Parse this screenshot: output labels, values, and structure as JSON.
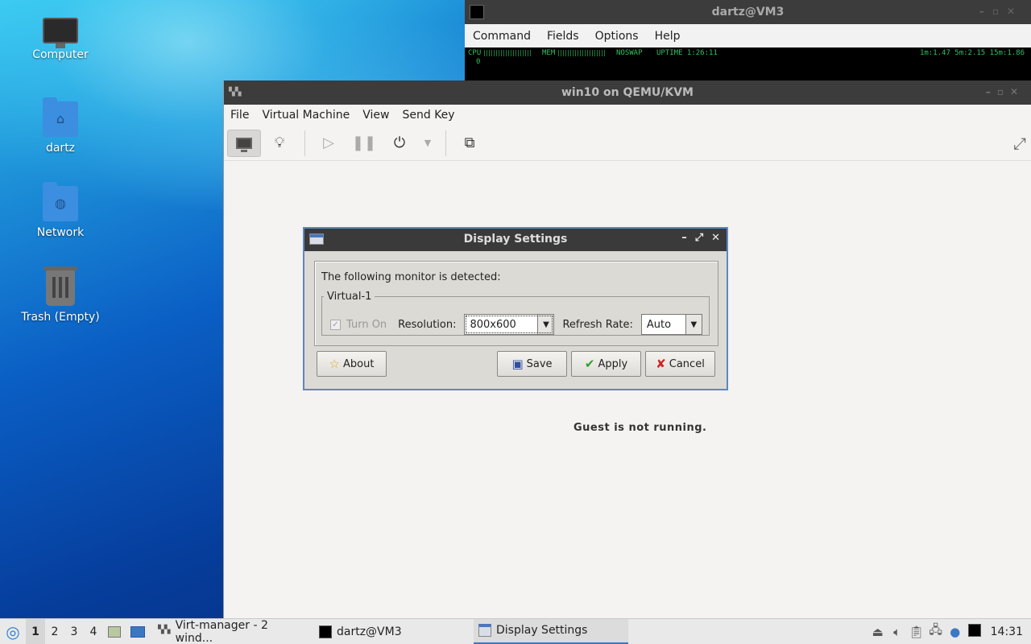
{
  "desktop": {
    "icons": [
      {
        "label": "Computer",
        "icon": "computer-icon"
      },
      {
        "label": "dartz",
        "icon": "home-folder-icon"
      },
      {
        "label": "Network",
        "icon": "network-folder-icon"
      },
      {
        "label": "Trash (Empty)",
        "icon": "trash-icon"
      }
    ]
  },
  "terminal": {
    "title": "dartz@VM3",
    "menu": [
      "Command",
      "Fields",
      "Options",
      "Help"
    ],
    "monitor": {
      "cpu": "CPU",
      "mem": "MEM",
      "noswap": "NOSWAP",
      "uptime": "UPTIME 1:26:11",
      "load": "1m:1.47 5m:2.15 15m:1.86",
      "zero": "0"
    }
  },
  "vm_window": {
    "title": "win10 on QEMU/KVM",
    "menu": [
      "File",
      "Virtual Machine",
      "View",
      "Send Key"
    ],
    "status": "Guest is not running."
  },
  "dialog": {
    "title": "Display Settings",
    "detected": "The following monitor is detected:",
    "monitor_name": "Virtual-1",
    "turn_on_label": "Turn On",
    "turn_on_checked": true,
    "resolution_label": "Resolution:",
    "resolution_value": "800x600",
    "refresh_label": "Refresh Rate:",
    "refresh_value": "Auto",
    "buttons": {
      "about": "About",
      "save": "Save",
      "apply": "Apply",
      "cancel": "Cancel"
    }
  },
  "taskbar": {
    "workspaces": [
      "1",
      "2",
      "3",
      "4"
    ],
    "current_workspace": "1",
    "tasks": [
      {
        "label": "Virt-manager - 2 wind...",
        "icon": "virt-manager-icon"
      },
      {
        "label": "dartz@VM3",
        "icon": "terminal-icon"
      },
      {
        "label": "Display Settings",
        "icon": "display-settings-icon"
      }
    ],
    "clock": "14:31"
  },
  "colors": {
    "accent": "#3a78c4",
    "titlebar": "#3c3c3c",
    "dialog_border": "#5f87c0"
  }
}
